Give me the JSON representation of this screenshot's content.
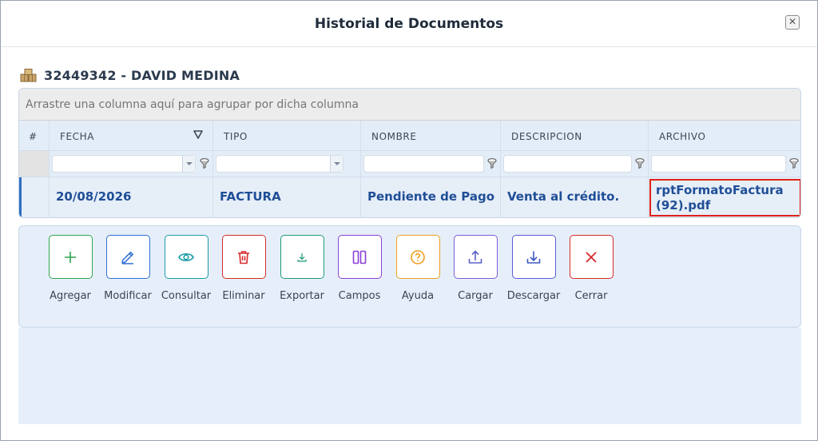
{
  "dialog": {
    "title": "Historial de Documentos",
    "close_glyph": "✕"
  },
  "record": {
    "title": "32449342 - DAVID MEDINA",
    "icon": "boxes-icon"
  },
  "grid": {
    "group_panel_text": "Arrastre una columna aquí para agrupar por dicha columna",
    "columns": [
      "#",
      "FECHA",
      "TIPO",
      "NOMBRE",
      "DESCRIPCION",
      "ARCHIVO"
    ],
    "rows": [
      {
        "num": "",
        "fecha": "20/08/2026",
        "tipo": "FACTURA",
        "nombre": "Pendiente de Pago",
        "descripcion": "Venta al crédito.",
        "archivo_line1": "rptFormatoFactura",
        "archivo_line2": "(92).pdf"
      }
    ],
    "highlight_color": "#e0201b"
  },
  "toolbar": {
    "buttons": [
      {
        "label": "Agregar",
        "icon": "plus-icon",
        "color": "#2ea44f"
      },
      {
        "label": "Modificar",
        "icon": "pencil-icon",
        "color": "#2f6fd6"
      },
      {
        "label": "Consultar",
        "icon": "eye-icon",
        "color": "#1a9aa8"
      },
      {
        "label": "Eliminar",
        "icon": "trash-icon",
        "color": "#d62a2a"
      },
      {
        "label": "Exportar",
        "icon": "export-icon",
        "color": "#1f9a77"
      },
      {
        "label": "Campos",
        "icon": "columns-icon",
        "color": "#8a3fd8"
      },
      {
        "label": "Ayuda",
        "icon": "help-icon",
        "color": "#f0a020"
      },
      {
        "label": "Cargar",
        "icon": "upload-icon",
        "color": "#7a5cd8"
      },
      {
        "label": "Descargar",
        "icon": "download-icon",
        "color": "#5a5ad8"
      },
      {
        "label": "Cerrar",
        "icon": "close-icon",
        "color": "#d62a2a"
      }
    ]
  }
}
